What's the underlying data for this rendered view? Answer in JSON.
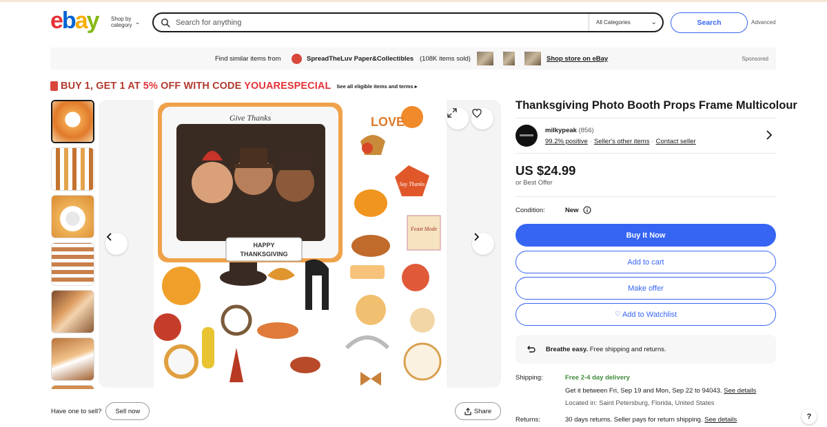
{
  "header": {
    "logo_text": "ebay",
    "shop_by_line1": "Shop by",
    "shop_by_line2": "category",
    "search_placeholder": "Search for anything",
    "category_selected": "All Categories",
    "search_button": "Search",
    "advanced_link": "Advanced"
  },
  "sponsor_bar": {
    "find_text": "Find similar items from",
    "store_name": "SpreadTheLuv Paper&Collectibles",
    "items_sold": "(108K items sold)",
    "shop_store_link": "Shop store on eBay",
    "sponsored_label": "Sponsored"
  },
  "promo": {
    "text_part1": "BUY 1, GET 1 AT ",
    "text_highlight": "5%",
    "text_part2": " OFF WITH CODE ",
    "code": "YOUARESPECIAL",
    "terms_link": "See all eligible items and terms ▸"
  },
  "gallery": {
    "selected_index": 0,
    "thumbnail_count": 7,
    "image_text_top": "Give Thanks",
    "image_text_banner_1": "HAPPY",
    "image_text_banner_2": "THANKSGIVING",
    "image_text_love": "LOVE",
    "image_text_say": "Say Thanks",
    "image_text_feast": "Feast Mode"
  },
  "sell": {
    "question": "Have one to sell?",
    "sell_now_button": "Sell now",
    "share_button": "Share"
  },
  "item": {
    "title": "Thanksgiving Photo Booth Props Frame Multicolour",
    "seller_name": "milkypeak",
    "seller_feedback_count": "(856)",
    "positive": "99.2% positive",
    "other_items_link": "Seller's other items",
    "contact_link": "Contact seller",
    "price": "US $24.99",
    "best_offer": "or Best Offer",
    "condition_label": "Condition:",
    "condition_value": "New",
    "buy_now": "Buy It Now",
    "add_to_cart": "Add to cart",
    "make_offer": "Make offer",
    "add_to_watchlist": "Add to Watchlist",
    "breathe_bold": "Breathe easy.",
    "breathe_text": " Free shipping and returns.",
    "shipping_label": "Shipping:",
    "shipping_free": "Free 2-4 day delivery",
    "shipping_get": "Get it between Fri, Sep 19 and Mon, Sep 22 to 94043. ",
    "see_details": "See details",
    "located": "Located in: Saint Petersburg, Florida, United States",
    "returns_label": "Returns:",
    "returns_text": "30 days returns. Seller pays for return shipping. ",
    "returns_details": "See details"
  },
  "colors": {
    "brand_blue": "#3665f3",
    "promo_red": "#e53238",
    "free_green": "#3f8a3a"
  }
}
